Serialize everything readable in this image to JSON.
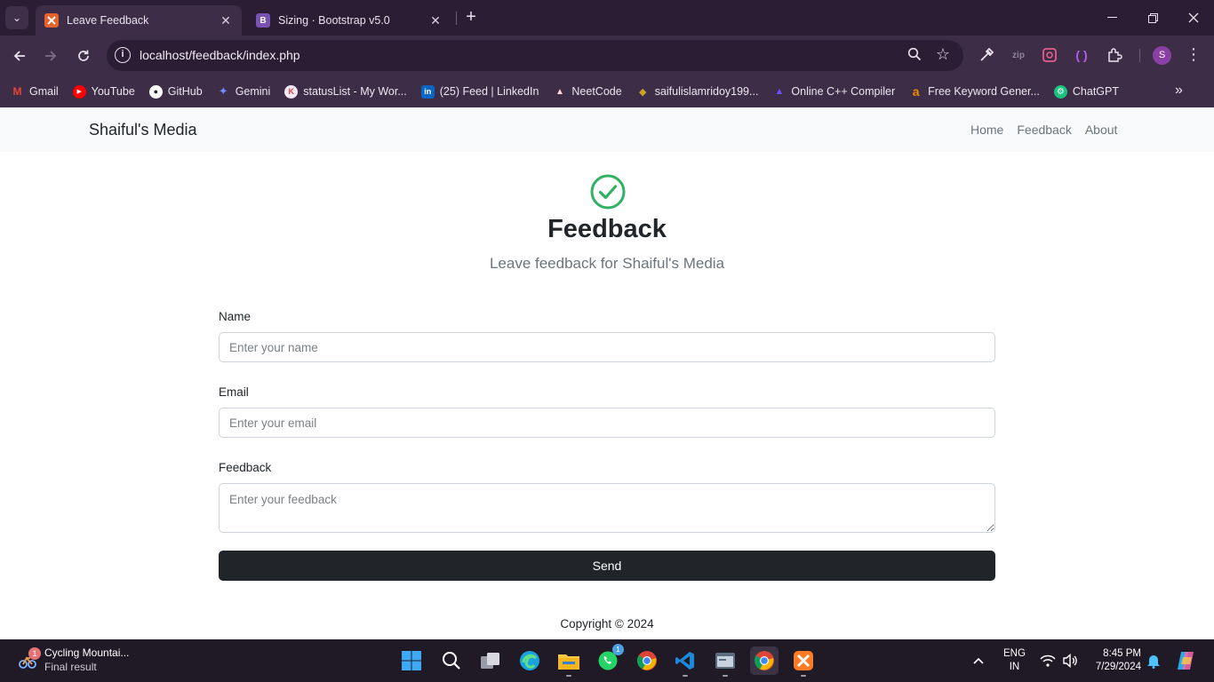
{
  "browser": {
    "tabs": [
      {
        "title": "Leave Feedback",
        "favicon_color": "#e8622c",
        "active": true
      },
      {
        "title": "Sizing · Bootstrap v5.0",
        "favicon_letter": "B",
        "favicon_color": "#7952b3",
        "active": false
      }
    ],
    "url": "localhost/feedback/index.php",
    "avatar_letter": "S",
    "bookmarks": [
      {
        "label": "Gmail",
        "icon": "gmail-icon",
        "color": "#ea4335",
        "letter": "M"
      },
      {
        "label": "YouTube",
        "icon": "youtube-icon",
        "color": "#ff0000",
        "letter": "▶"
      },
      {
        "label": "GitHub",
        "icon": "github-icon",
        "color": "#ffffff",
        "letter": "●"
      },
      {
        "label": "Gemini",
        "icon": "gemini-icon",
        "color": "#6f8cff",
        "letter": "✦"
      },
      {
        "label": "statusList - My Wor...",
        "icon": "statuslist-icon",
        "color": "#ffffff",
        "letter": "⟨"
      },
      {
        "label": "(25) Feed | LinkedIn",
        "icon": "linkedin-icon",
        "color": "#0a66c2",
        "letter": "in"
      },
      {
        "label": "NeetCode",
        "icon": "neetcode-icon",
        "color": "#c33",
        "letter": "●"
      },
      {
        "label": "saifulislamridoy199...",
        "icon": "profile-icon",
        "color": "#c9a227",
        "letter": "◆"
      },
      {
        "label": "Online C++ Compiler",
        "icon": "compiler-icon",
        "color": "#6a4df4",
        "letter": "▲"
      },
      {
        "label": "Free Keyword Gener...",
        "icon": "keyword-tool-icon",
        "color": "#f08a00",
        "letter": "a"
      },
      {
        "label": "ChatGPT",
        "icon": "chatgpt-icon",
        "color": "#19c37d",
        "letter": "⚙"
      }
    ]
  },
  "site": {
    "brand": "Shaiful's Media",
    "nav": [
      "Home",
      "Feedback",
      "About"
    ],
    "hero": {
      "title": "Feedback",
      "subtitle": "Leave feedback for Shaiful's Media",
      "icon": "check-circle-icon",
      "icon_color": "#2fb362"
    },
    "form": {
      "name_label": "Name",
      "name_placeholder": "Enter your name",
      "email_label": "Email",
      "email_placeholder": "Enter your email",
      "feedback_label": "Feedback",
      "feedback_placeholder": "Enter your feedback",
      "submit_label": "Send"
    },
    "footer": "Copyright © 2024"
  },
  "taskbar": {
    "weather": {
      "title": "Cycling Mountai...",
      "subtitle": "Final result",
      "badge": "1"
    },
    "whatsapp_badge": "1",
    "language": {
      "line1": "ENG",
      "line2": "IN"
    },
    "clock": {
      "time": "8:45 PM",
      "date": "7/29/2024"
    }
  }
}
